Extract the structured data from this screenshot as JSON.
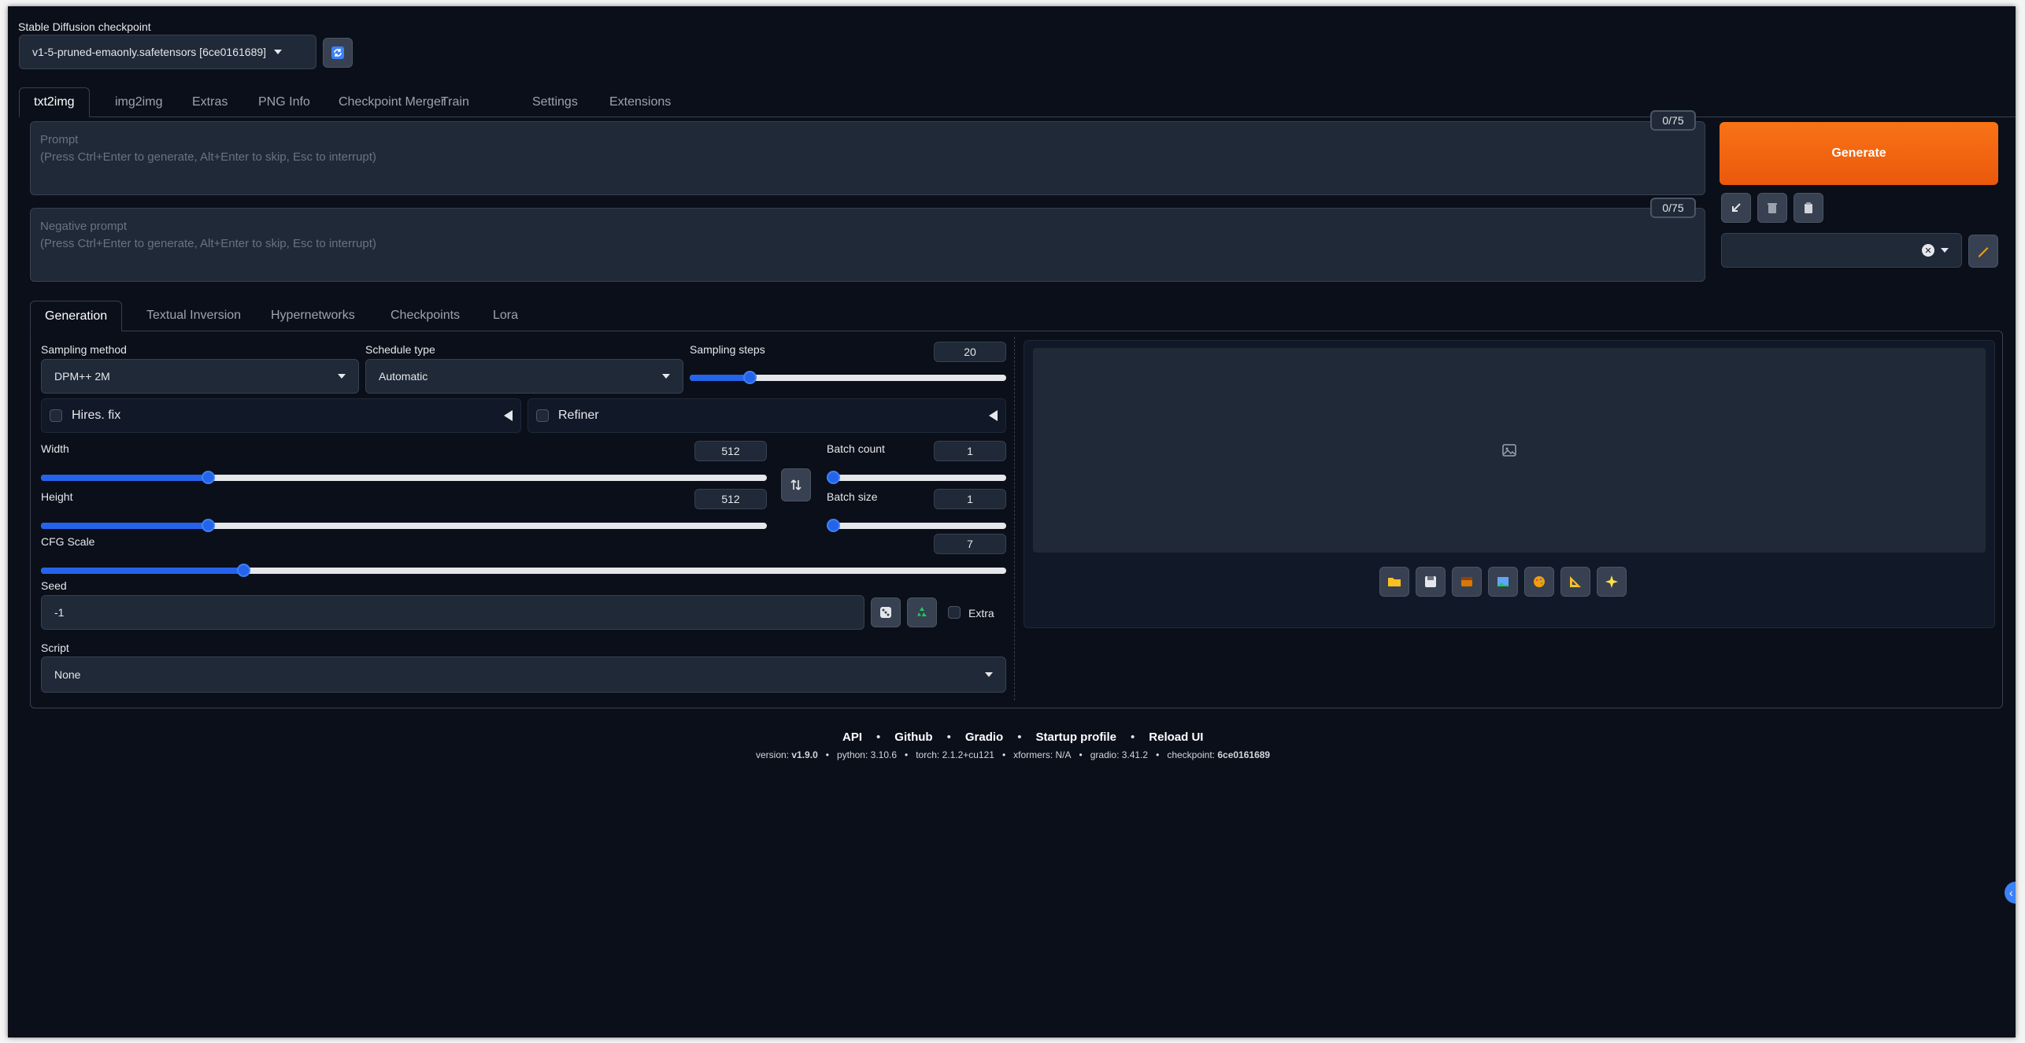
{
  "checkpoint": {
    "label": "Stable Diffusion checkpoint",
    "value": "v1-5-pruned-emaonly.safetensors [6ce0161689]",
    "refresh_icon": "refresh-icon"
  },
  "main_tabs": [
    {
      "label": "txt2img",
      "active": true
    },
    {
      "label": "img2img"
    },
    {
      "label": "Extras"
    },
    {
      "label": "PNG Info"
    },
    {
      "label": "Checkpoint Merger"
    },
    {
      "label": "Train"
    },
    {
      "label": "Settings"
    },
    {
      "label": "Extensions"
    }
  ],
  "prompt": {
    "label": "Prompt",
    "placeholder": "(Press Ctrl+Enter to generate, Alt+Enter to skip, Esc to interrupt)",
    "counter": "0/75"
  },
  "negative_prompt": {
    "label": "Negative prompt",
    "placeholder": "(Press Ctrl+Enter to generate, Alt+Enter to skip, Esc to interrupt)",
    "counter": "0/75"
  },
  "generate_label": "Generate",
  "style_tools": [
    "arrow-icon",
    "trash-icon",
    "clipboard-icon"
  ],
  "sub_tabs": [
    {
      "label": "Generation",
      "active": true
    },
    {
      "label": "Textual Inversion"
    },
    {
      "label": "Hypernetworks"
    },
    {
      "label": "Checkpoints"
    },
    {
      "label": "Lora"
    }
  ],
  "sampling": {
    "method_label": "Sampling method",
    "method_value": "DPM++ 2M",
    "schedule_label": "Schedule type",
    "schedule_value": "Automatic",
    "steps_label": "Sampling steps",
    "steps_value": "20",
    "steps_fraction": 0.19
  },
  "hires_fix": {
    "label": "Hires. fix"
  },
  "refiner": {
    "label": "Refiner"
  },
  "width": {
    "label": "Width",
    "value": "512",
    "fraction": 0.23
  },
  "height": {
    "label": "Height",
    "value": "512",
    "fraction": 0.23
  },
  "batch_count": {
    "label": "Batch count",
    "value": "1",
    "fraction": 0.0
  },
  "batch_size": {
    "label": "Batch size",
    "value": "1",
    "fraction": 0.0
  },
  "cfg": {
    "label": "CFG Scale",
    "value": "7",
    "fraction": 0.21
  },
  "seed": {
    "label": "Seed",
    "value": "-1",
    "extra_label": "Extra"
  },
  "script": {
    "label": "Script",
    "value": "None"
  },
  "output_tools": [
    "folder-icon",
    "save-icon",
    "zip-icon",
    "image-icon",
    "palette-icon",
    "ruler-icon",
    "sparkle-icon"
  ],
  "footer": {
    "links": [
      "API",
      "Github",
      "Gradio",
      "Startup profile",
      "Reload UI"
    ],
    "version_label": "version:",
    "version": "v1.9.0",
    "python": "python: 3.10.6",
    "torch": "torch: 2.1.2+cu121",
    "xformers": "xformers: N/A",
    "gradio": "gradio: 3.41.2",
    "checkpoint_label": "checkpoint:",
    "checkpoint": "6ce0161689"
  }
}
